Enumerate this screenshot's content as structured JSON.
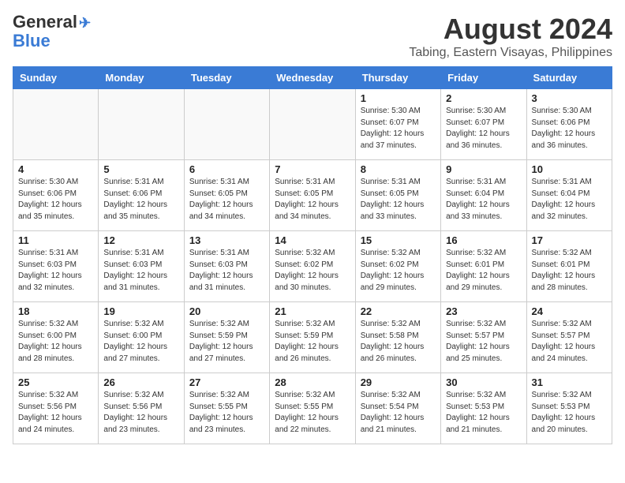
{
  "logo": {
    "line1": "General",
    "line2": "Blue"
  },
  "title": "August 2024",
  "location": "Tabing, Eastern Visayas, Philippines",
  "days_of_week": [
    "Sunday",
    "Monday",
    "Tuesday",
    "Wednesday",
    "Thursday",
    "Friday",
    "Saturday"
  ],
  "weeks": [
    [
      {
        "day": "",
        "info": ""
      },
      {
        "day": "",
        "info": ""
      },
      {
        "day": "",
        "info": ""
      },
      {
        "day": "",
        "info": ""
      },
      {
        "day": "1",
        "info": "Sunrise: 5:30 AM\nSunset: 6:07 PM\nDaylight: 12 hours\nand 37 minutes."
      },
      {
        "day": "2",
        "info": "Sunrise: 5:30 AM\nSunset: 6:07 PM\nDaylight: 12 hours\nand 36 minutes."
      },
      {
        "day": "3",
        "info": "Sunrise: 5:30 AM\nSunset: 6:06 PM\nDaylight: 12 hours\nand 36 minutes."
      }
    ],
    [
      {
        "day": "4",
        "info": "Sunrise: 5:30 AM\nSunset: 6:06 PM\nDaylight: 12 hours\nand 35 minutes."
      },
      {
        "day": "5",
        "info": "Sunrise: 5:31 AM\nSunset: 6:06 PM\nDaylight: 12 hours\nand 35 minutes."
      },
      {
        "day": "6",
        "info": "Sunrise: 5:31 AM\nSunset: 6:05 PM\nDaylight: 12 hours\nand 34 minutes."
      },
      {
        "day": "7",
        "info": "Sunrise: 5:31 AM\nSunset: 6:05 PM\nDaylight: 12 hours\nand 34 minutes."
      },
      {
        "day": "8",
        "info": "Sunrise: 5:31 AM\nSunset: 6:05 PM\nDaylight: 12 hours\nand 33 minutes."
      },
      {
        "day": "9",
        "info": "Sunrise: 5:31 AM\nSunset: 6:04 PM\nDaylight: 12 hours\nand 33 minutes."
      },
      {
        "day": "10",
        "info": "Sunrise: 5:31 AM\nSunset: 6:04 PM\nDaylight: 12 hours\nand 32 minutes."
      }
    ],
    [
      {
        "day": "11",
        "info": "Sunrise: 5:31 AM\nSunset: 6:03 PM\nDaylight: 12 hours\nand 32 minutes."
      },
      {
        "day": "12",
        "info": "Sunrise: 5:31 AM\nSunset: 6:03 PM\nDaylight: 12 hours\nand 31 minutes."
      },
      {
        "day": "13",
        "info": "Sunrise: 5:31 AM\nSunset: 6:03 PM\nDaylight: 12 hours\nand 31 minutes."
      },
      {
        "day": "14",
        "info": "Sunrise: 5:32 AM\nSunset: 6:02 PM\nDaylight: 12 hours\nand 30 minutes."
      },
      {
        "day": "15",
        "info": "Sunrise: 5:32 AM\nSunset: 6:02 PM\nDaylight: 12 hours\nand 29 minutes."
      },
      {
        "day": "16",
        "info": "Sunrise: 5:32 AM\nSunset: 6:01 PM\nDaylight: 12 hours\nand 29 minutes."
      },
      {
        "day": "17",
        "info": "Sunrise: 5:32 AM\nSunset: 6:01 PM\nDaylight: 12 hours\nand 28 minutes."
      }
    ],
    [
      {
        "day": "18",
        "info": "Sunrise: 5:32 AM\nSunset: 6:00 PM\nDaylight: 12 hours\nand 28 minutes."
      },
      {
        "day": "19",
        "info": "Sunrise: 5:32 AM\nSunset: 6:00 PM\nDaylight: 12 hours\nand 27 minutes."
      },
      {
        "day": "20",
        "info": "Sunrise: 5:32 AM\nSunset: 5:59 PM\nDaylight: 12 hours\nand 27 minutes."
      },
      {
        "day": "21",
        "info": "Sunrise: 5:32 AM\nSunset: 5:59 PM\nDaylight: 12 hours\nand 26 minutes."
      },
      {
        "day": "22",
        "info": "Sunrise: 5:32 AM\nSunset: 5:58 PM\nDaylight: 12 hours\nand 26 minutes."
      },
      {
        "day": "23",
        "info": "Sunrise: 5:32 AM\nSunset: 5:57 PM\nDaylight: 12 hours\nand 25 minutes."
      },
      {
        "day": "24",
        "info": "Sunrise: 5:32 AM\nSunset: 5:57 PM\nDaylight: 12 hours\nand 24 minutes."
      }
    ],
    [
      {
        "day": "25",
        "info": "Sunrise: 5:32 AM\nSunset: 5:56 PM\nDaylight: 12 hours\nand 24 minutes."
      },
      {
        "day": "26",
        "info": "Sunrise: 5:32 AM\nSunset: 5:56 PM\nDaylight: 12 hours\nand 23 minutes."
      },
      {
        "day": "27",
        "info": "Sunrise: 5:32 AM\nSunset: 5:55 PM\nDaylight: 12 hours\nand 23 minutes."
      },
      {
        "day": "28",
        "info": "Sunrise: 5:32 AM\nSunset: 5:55 PM\nDaylight: 12 hours\nand 22 minutes."
      },
      {
        "day": "29",
        "info": "Sunrise: 5:32 AM\nSunset: 5:54 PM\nDaylight: 12 hours\nand 21 minutes."
      },
      {
        "day": "30",
        "info": "Sunrise: 5:32 AM\nSunset: 5:53 PM\nDaylight: 12 hours\nand 21 minutes."
      },
      {
        "day": "31",
        "info": "Sunrise: 5:32 AM\nSunset: 5:53 PM\nDaylight: 12 hours\nand 20 minutes."
      }
    ]
  ]
}
